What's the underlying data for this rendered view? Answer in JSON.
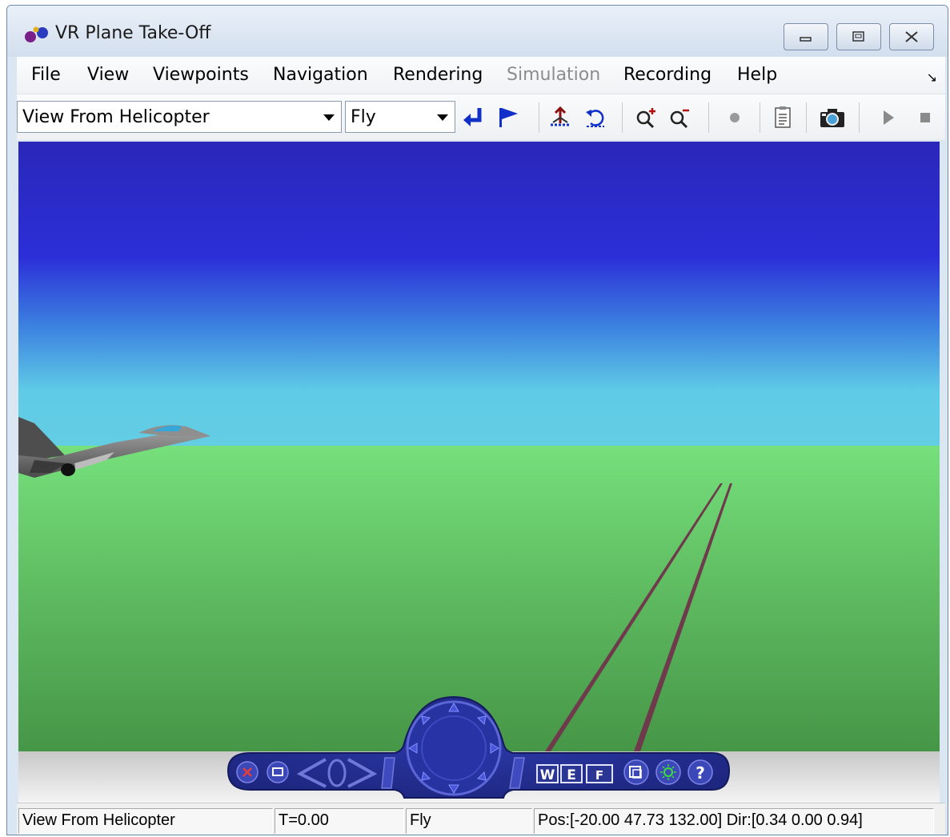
{
  "window": {
    "title": "VR Plane Take-Off"
  },
  "menubar": {
    "items": [
      {
        "label": "File",
        "enabled": true
      },
      {
        "label": "View",
        "enabled": true
      },
      {
        "label": "Viewpoints",
        "enabled": true
      },
      {
        "label": "Navigation",
        "enabled": true
      },
      {
        "label": "Rendering",
        "enabled": true
      },
      {
        "label": "Simulation",
        "enabled": false
      },
      {
        "label": "Recording",
        "enabled": true
      },
      {
        "label": "Help",
        "enabled": true
      }
    ]
  },
  "toolbar": {
    "viewpoint_select": "View From Helicopter",
    "navigation_select": "Fly",
    "icons": [
      "return-to-viewpoint-icon",
      "create-viewpoint-flag-icon",
      "straighten-up-icon",
      "undo-move-icon",
      "zoom-in-icon",
      "zoom-out-icon",
      "record-icon",
      "capture-frame-icon",
      "snapshot-camera-icon",
      "play-icon",
      "stop-icon"
    ]
  },
  "nav_panel": {
    "letters": [
      "W",
      "E",
      "F"
    ],
    "help_label": "?"
  },
  "status": {
    "viewpoint": "View From Helicopter",
    "time": "T=0.00",
    "mode": "Fly",
    "position": "Pos:[-20.00 47.73 132.00] Dir:[0.34 0.00 0.94]"
  },
  "colors": {
    "sky_top": "#2a27b9",
    "sky_horizon": "#5fcbe6",
    "ground_near": "#469647",
    "ground_far": "#76e07c",
    "runway": "#6e3a4c",
    "nav_panel": "#2b3593"
  }
}
